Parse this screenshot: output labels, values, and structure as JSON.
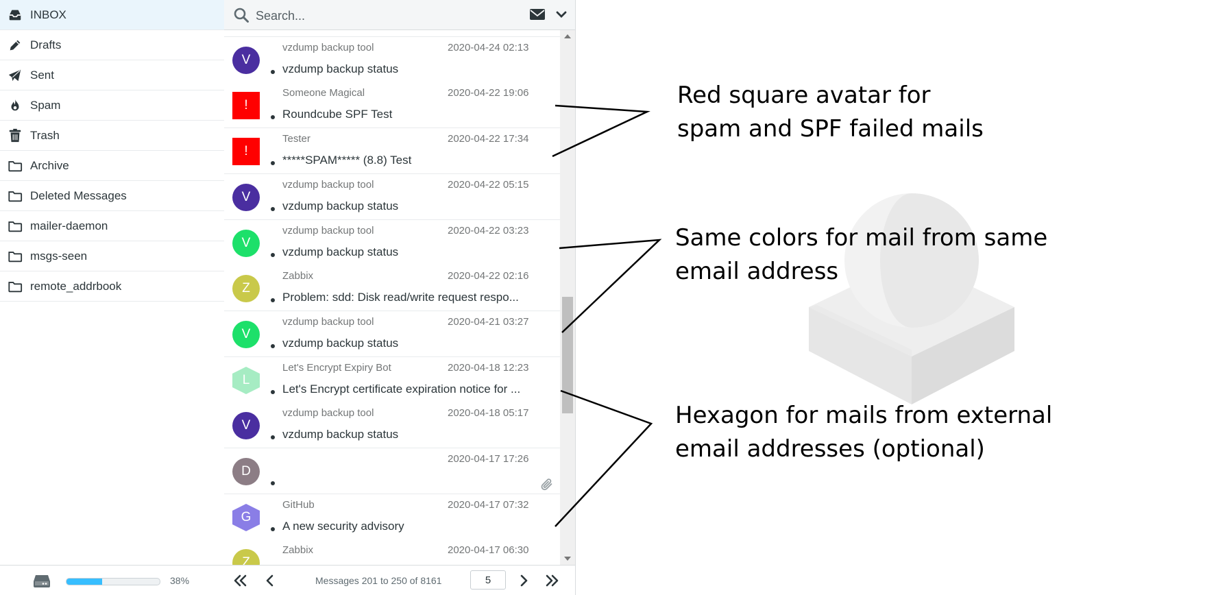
{
  "sidebar": {
    "folders": [
      {
        "label": "INBOX",
        "icon": "inbox-icon"
      },
      {
        "label": "Drafts",
        "icon": "pencil-icon"
      },
      {
        "label": "Sent",
        "icon": "paper-plane-icon"
      },
      {
        "label": "Spam",
        "icon": "fire-icon"
      },
      {
        "label": "Trash",
        "icon": "trash-icon"
      },
      {
        "label": "Archive",
        "icon": "folder-icon"
      },
      {
        "label": "Deleted Messages",
        "icon": "folder-icon"
      },
      {
        "label": "mailer-daemon",
        "icon": "folder-icon"
      },
      {
        "label": "msgs-seen",
        "icon": "folder-icon"
      },
      {
        "label": "remote_addrbook",
        "icon": "folder-icon"
      }
    ],
    "quota": {
      "percent": 38,
      "label": "38%",
      "icon": "hard-drive-icon"
    }
  },
  "search": {
    "placeholder": "Search...",
    "envelope_icon": "envelope-icon",
    "options_icon": "chevron-down-icon"
  },
  "messages": [
    {
      "from": "",
      "date": "",
      "subject": "vzdump backup status",
      "initial": "",
      "shape": "round",
      "color": "#1de06a",
      "partial": true
    },
    {
      "from": "vzdump backup tool",
      "date": "2020-04-24 02:13",
      "subject": "vzdump backup status",
      "initial": "V",
      "shape": "round",
      "color": "#4a2ea0"
    },
    {
      "from": "Someone Magical",
      "date": "2020-04-22 19:06",
      "subject": "Roundcube SPF Test",
      "initial": "!",
      "shape": "square",
      "color": "#ff0000"
    },
    {
      "from": "Tester",
      "date": "2020-04-22 17:34",
      "subject": "*****SPAM***** (8.8) Test",
      "initial": "!",
      "shape": "square",
      "color": "#ff0000"
    },
    {
      "from": "vzdump backup tool",
      "date": "2020-04-22 05:15",
      "subject": "vzdump backup status",
      "initial": "V",
      "shape": "round",
      "color": "#4a2ea0"
    },
    {
      "from": "vzdump backup tool",
      "date": "2020-04-22 03:23",
      "subject": "vzdump backup status",
      "initial": "V",
      "shape": "round",
      "color": "#1de06a"
    },
    {
      "from": "Zabbix",
      "date": "2020-04-22 02:16",
      "subject": "Problem: sdd: Disk read/write request respo...",
      "initial": "Z",
      "shape": "round",
      "color": "#c9c94a"
    },
    {
      "from": "vzdump backup tool",
      "date": "2020-04-21 03:27",
      "subject": "vzdump backup status",
      "initial": "V",
      "shape": "round",
      "color": "#1de06a"
    },
    {
      "from": "Let's Encrypt Expiry Bot",
      "date": "2020-04-18 12:23",
      "subject": "Let's Encrypt certificate expiration notice for ...",
      "initial": "L",
      "shape": "hex",
      "color": "#a6ecc3"
    },
    {
      "from": "vzdump backup tool",
      "date": "2020-04-18 05:17",
      "subject": "vzdump backup status",
      "initial": "V",
      "shape": "round",
      "color": "#4a2ea0"
    },
    {
      "from": "",
      "date": "2020-04-17 17:26",
      "subject": "",
      "initial": "D",
      "shape": "round",
      "color": "#8c7d85",
      "attachment": true
    },
    {
      "from": "GitHub",
      "date": "2020-04-17 07:32",
      "subject": "A new security advisory",
      "initial": "G",
      "shape": "hex",
      "color": "#8a7ee6"
    },
    {
      "from": "Zabbix",
      "date": "2020-04-17 06:30",
      "subject": "",
      "initial": "Z",
      "shape": "round",
      "color": "#c9c94a",
      "partial": true
    }
  ],
  "pager": {
    "text": "Messages 201 to 250 of 8161",
    "page": "5"
  },
  "annotations": [
    "Red square avatar for\nspam and SPF failed mails",
    "Same colors for mail from same\nemail address",
    "Hexagon for mails from external\nemail addresses (optional)"
  ]
}
